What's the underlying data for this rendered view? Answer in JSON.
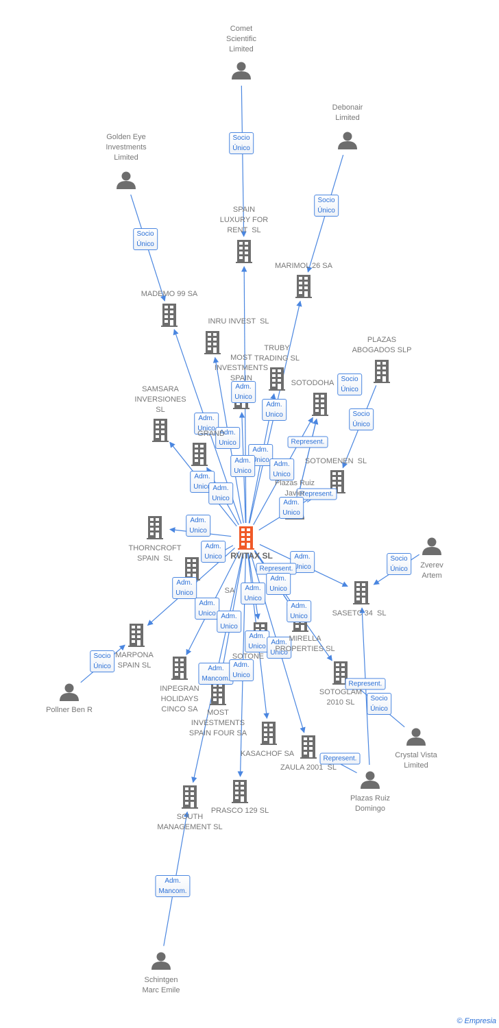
{
  "center": {
    "label": "RVITAX SL",
    "color": "#f05a28"
  },
  "colors": {
    "edge": "#4a86e0",
    "node": "#6d6d6d",
    "text": "#777777"
  },
  "nodes": [
    {
      "id": "comet",
      "type": "person",
      "label": "Comet\nScientific\nLimited"
    },
    {
      "id": "debonair",
      "type": "person",
      "label": "Debonair\nLimited"
    },
    {
      "id": "goldeneye",
      "type": "person",
      "label": "Golden Eye\nInvestments\nLimited"
    },
    {
      "id": "spainluxury",
      "type": "company",
      "label": "SPAIN\nLUXURY FOR\nRENT  SL"
    },
    {
      "id": "marimol",
      "type": "company",
      "label": "MARIMOL 26 SA"
    },
    {
      "id": "mademo",
      "type": "company",
      "label": "MADEMO 99 SA"
    },
    {
      "id": "inru",
      "type": "company",
      "label": "INRU INVEST  SL"
    },
    {
      "id": "mostspain",
      "type": "company",
      "label": "MOST\nINVESTMENTS\nSPAIN"
    },
    {
      "id": "truby",
      "type": "company",
      "label": "TRUBY\nTRADING SL"
    },
    {
      "id": "plazasabogados",
      "type": "company",
      "label": "PLAZAS\nABOGADOS SLP"
    },
    {
      "id": "sotodoha",
      "type": "company",
      "label": "SOTODOHA"
    },
    {
      "id": "samsara",
      "type": "company",
      "label": "SAMSARA\nINVERSIONES\nSL"
    },
    {
      "id": "grand",
      "type": "company",
      "label": "GRAND"
    },
    {
      "id": "sotomenen",
      "type": "company",
      "label": "SOTOMENEN  SL"
    },
    {
      "id": "plazasjavier",
      "type": "person",
      "label": "Plazas Ruiz\nJavier"
    },
    {
      "id": "thorncroft",
      "type": "company",
      "label": "THORNCROFT\nSPAIN  SL"
    },
    {
      "id": "sa",
      "type": "company",
      "label": "SA"
    },
    {
      "id": "zverev",
      "type": "person",
      "label": "Zverev\nArtem"
    },
    {
      "id": "sasetc",
      "type": "company",
      "label": "SASETC 34  SL"
    },
    {
      "id": "marpona",
      "type": "company",
      "label": "MARPONA\nSPAIN SL"
    },
    {
      "id": "pollner",
      "type": "person",
      "label": "Pollner Ben R"
    },
    {
      "id": "inpegran",
      "type": "company",
      "label": "INPEGRAN\nHOLIDAYS\nCINCO SA"
    },
    {
      "id": "mostfour",
      "type": "company",
      "label": "MOST\nINVESTMENTS\nSPAIN FOUR SA"
    },
    {
      "id": "sotone",
      "type": "company",
      "label": "SOTONE"
    },
    {
      "id": "mirella",
      "type": "company",
      "label": "MIRELLA\nPROPERTIES SL"
    },
    {
      "id": "sotoglam",
      "type": "company",
      "label": "SOTOGLAM\n2010 SL"
    },
    {
      "id": "crystal",
      "type": "person",
      "label": "Crystal Vista\nLimited"
    },
    {
      "id": "kasachof",
      "type": "company",
      "label": "KASACHOF SA"
    },
    {
      "id": "zaula",
      "type": "company",
      "label": "ZAULA 2001  SL"
    },
    {
      "id": "plazasdomingo",
      "type": "person",
      "label": "Plazas Ruiz\nDomingo"
    },
    {
      "id": "prasco",
      "type": "company",
      "label": "PRASCO 129 SL"
    },
    {
      "id": "southmgmt",
      "type": "company",
      "label": "SOUTH\nMANAGEMENT SL"
    },
    {
      "id": "schintgen",
      "type": "person",
      "label": "Schintgen\nMarc Emile"
    }
  ],
  "edges": [
    {
      "from": "comet",
      "to": "spainluxury",
      "label": "Socio\nÚnico"
    },
    {
      "from": "debonair",
      "to": "marimol",
      "label": "Socio\nÚnico"
    },
    {
      "from": "goldeneye",
      "to": "mademo",
      "label": "Socio\nÚnico"
    },
    {
      "from": "plazasjavier",
      "to": "sotodoha",
      "label": "Socio\nÚnico"
    },
    {
      "from": "plazasabogados",
      "to": "sotomenen",
      "label": "Socio\nÚnico"
    },
    {
      "from": "center",
      "to": "spainluxury",
      "label": "Adm.\nUnico"
    },
    {
      "from": "center",
      "to": "marimol",
      "label": "Adm.\nUnico"
    },
    {
      "from": "center",
      "to": "mademo",
      "label": "Adm.\nUnico"
    },
    {
      "from": "center",
      "to": "inru",
      "label": "Adm.\nUnico"
    },
    {
      "from": "center",
      "to": "mostspain",
      "label": "Adm.\nUnico"
    },
    {
      "from": "plazasjavier",
      "to": "sotodoha",
      "label": "Represent."
    },
    {
      "from": "center",
      "to": "truby",
      "label": "Adm.\nUnico"
    },
    {
      "from": "center",
      "to": "sotodoha",
      "label": "Adm.\nUnico"
    },
    {
      "from": "center",
      "to": "samsara",
      "label": "Adm.\nUnico"
    },
    {
      "from": "center",
      "to": "grand",
      "label": "Adm.\nUnico"
    },
    {
      "from": "plazasjavier",
      "to": "sotomenen",
      "label": "Represent."
    },
    {
      "from": "center",
      "to": "sotomenen",
      "label": "Adm.\nUnico"
    },
    {
      "from": "center",
      "to": "thorncroft",
      "label": "Adm.\nUnico"
    },
    {
      "from": "center",
      "to": "sa",
      "label": "Adm.\nUnico"
    },
    {
      "from": "center",
      "to": "sasetc",
      "label": "Adm.\nUnico"
    },
    {
      "from": "center",
      "to": "mirella",
      "label": "Represent."
    },
    {
      "from": "center",
      "to": "mirella",
      "label": "Adm.\nUnico"
    },
    {
      "from": "center",
      "to": "marpona",
      "label": "Adm.\nUnico"
    },
    {
      "from": "center",
      "to": "sotone",
      "label": "Adm.\nUnico"
    },
    {
      "from": "center",
      "to": "inpegran",
      "label": "Adm.\nUnico"
    },
    {
      "from": "center",
      "to": "sotoglam",
      "label": "Adm.\nUnico"
    },
    {
      "from": "center",
      "to": "mostfour",
      "label": "Adm.\nUnico"
    },
    {
      "from": "center",
      "to": "kasachof",
      "label": "Adm.\nUnico"
    },
    {
      "from": "center",
      "to": "zaula",
      "label": "Adm.\nUnico"
    },
    {
      "from": "center",
      "to": "southmgmt",
      "label": "Adm.\nMancom."
    },
    {
      "from": "center",
      "to": "prasco",
      "label": "Adm.\nUnico"
    },
    {
      "from": "zverev",
      "to": "sasetc",
      "label": "Socio\nÚnico"
    },
    {
      "from": "pollner",
      "to": "marpona",
      "label": "Socio\nÚnico"
    },
    {
      "from": "plazasdomingo",
      "to": "sasetc",
      "label": "Represent."
    },
    {
      "from": "crystal",
      "to": "sotoglam",
      "label": "Socio\nÚnico"
    },
    {
      "from": "plazasdomingo",
      "to": "zaula",
      "label": "Represent."
    },
    {
      "from": "schintgen",
      "to": "southmgmt",
      "label": "Adm.\nMancom."
    }
  ],
  "footer": {
    "copyright": "©",
    "brand": "Empresia"
  }
}
